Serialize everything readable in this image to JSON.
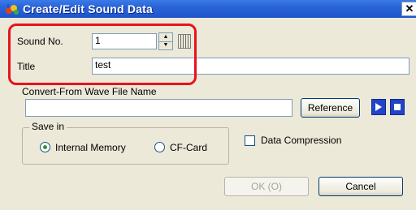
{
  "window": {
    "title": "Create/Edit Sound Data",
    "close_glyph": "✕"
  },
  "sound_no": {
    "label": "Sound No.",
    "value": "1",
    "spin_up": "▲",
    "spin_down": "▼"
  },
  "title_field": {
    "label": "Title",
    "value": "test"
  },
  "convert": {
    "label": "Convert-From Wave File Name",
    "value": "",
    "reference_label": "Reference"
  },
  "save_in": {
    "legend": "Save in",
    "options": [
      "Internal Memory",
      "CF-Card"
    ],
    "selected": "Internal Memory"
  },
  "compression": {
    "label": "Data Compression",
    "checked": false
  },
  "buttons": {
    "ok_label": "OK (O)",
    "cancel_label": "Cancel"
  },
  "colors": {
    "highlight": "#e8131e",
    "titlebar": "#2a63d8"
  }
}
